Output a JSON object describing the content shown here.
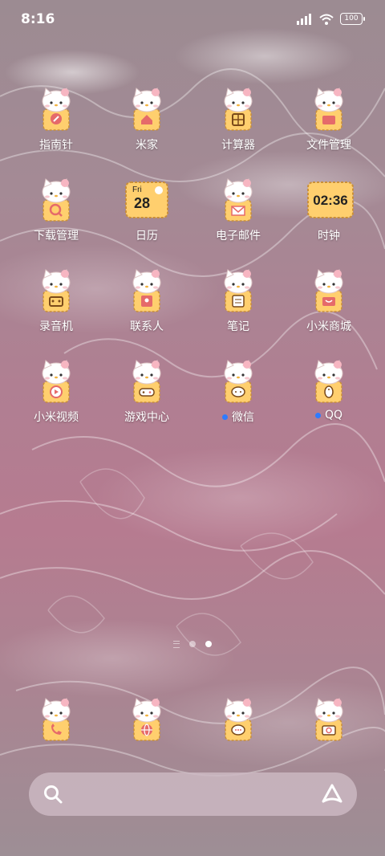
{
  "status_bar": {
    "time": "8:16",
    "battery": "100"
  },
  "apps": [
    {
      "label": "指南针",
      "has_dot": false,
      "glyph": "compass"
    },
    {
      "label": "米家",
      "has_dot": false,
      "glyph": "house"
    },
    {
      "label": "计算器",
      "has_dot": false,
      "glyph": "calculator"
    },
    {
      "label": "文件管理",
      "has_dot": false,
      "glyph": "folder"
    },
    {
      "label": "下载管理",
      "has_dot": false,
      "glyph": "download"
    },
    {
      "label": "日历",
      "has_dot": false,
      "glyph": "calendar",
      "day": "Fri",
      "date": "28"
    },
    {
      "label": "电子邮件",
      "has_dot": false,
      "glyph": "mail"
    },
    {
      "label": "时钟",
      "has_dot": false,
      "glyph": "clock",
      "clock_text": "02:36"
    },
    {
      "label": "录音机",
      "has_dot": false,
      "glyph": "recorder"
    },
    {
      "label": "联系人",
      "has_dot": false,
      "glyph": "contacts"
    },
    {
      "label": "笔记",
      "has_dot": false,
      "glyph": "notes"
    },
    {
      "label": "小米商城",
      "has_dot": false,
      "glyph": "store"
    },
    {
      "label": "小米视频",
      "has_dot": false,
      "glyph": "video"
    },
    {
      "label": "游戏中心",
      "has_dot": false,
      "glyph": "gamepad"
    },
    {
      "label": "微信",
      "has_dot": true,
      "glyph": "wechat"
    },
    {
      "label": "QQ",
      "has_dot": true,
      "glyph": "penguin"
    }
  ],
  "dock": [
    {
      "glyph": "phone"
    },
    {
      "glyph": "browser"
    },
    {
      "glyph": "message"
    },
    {
      "glyph": "camera"
    }
  ],
  "colors": {
    "icon_body": "#ffcf6e",
    "icon_accent": "#e56a6a",
    "unread_dot": "#2e7bff"
  }
}
